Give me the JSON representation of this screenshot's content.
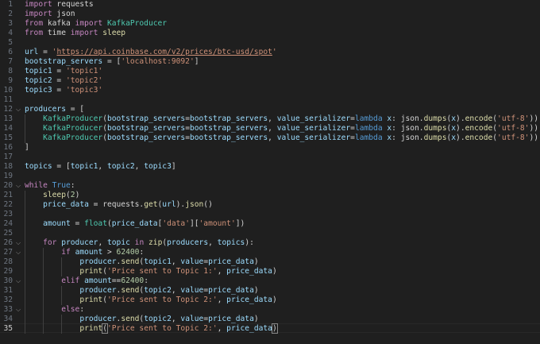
{
  "editor": {
    "language": "python",
    "active_line": 35,
    "colors": {
      "background": "#1f1f1f",
      "line_number": "#6e7681",
      "keyword_control": "#c586c0",
      "keyword": "#569cd6",
      "string": "#ce9178",
      "function": "#dcdcaa",
      "variable": "#9cdcfe",
      "number": "#b5cea8",
      "class": "#4ec9b0",
      "text": "#d4d4d4"
    },
    "folds": [
      {
        "line": 12,
        "icon": "chevron-down-icon"
      },
      {
        "line": 20,
        "icon": "chevron-down-icon"
      },
      {
        "line": 26,
        "icon": "chevron-down-icon"
      },
      {
        "line": 27,
        "icon": "chevron-down-icon"
      },
      {
        "line": 30,
        "icon": "chevron-down-icon"
      },
      {
        "line": 33,
        "icon": "chevron-down-icon"
      }
    ],
    "lines": [
      {
        "n": "1",
        "tokens": [
          [
            "import",
            "kw-ctrl"
          ],
          [
            " requests",
            "plain"
          ]
        ]
      },
      {
        "n": "2",
        "tokens": [
          [
            "import",
            "kw-ctrl"
          ],
          [
            " json",
            "plain"
          ]
        ]
      },
      {
        "n": "3",
        "tokens": [
          [
            "from",
            "kw-ctrl"
          ],
          [
            " kafka ",
            "plain"
          ],
          [
            "import",
            "kw-ctrl"
          ],
          [
            " KafkaProducer",
            "cls"
          ]
        ]
      },
      {
        "n": "4",
        "tokens": [
          [
            "from",
            "kw-ctrl"
          ],
          [
            " time ",
            "plain"
          ],
          [
            "import",
            "kw-ctrl"
          ],
          [
            " sleep",
            "fn"
          ]
        ]
      },
      {
        "n": "5",
        "tokens": []
      },
      {
        "n": "6",
        "tokens": [
          [
            "url",
            "var"
          ],
          [
            " = ",
            "plain"
          ],
          [
            "'",
            "str"
          ],
          [
            "https://api.coinbase.com/v2/prices/btc-usd/spot",
            "str url-link"
          ],
          [
            "'",
            "str"
          ]
        ]
      },
      {
        "n": "7",
        "tokens": [
          [
            "bootstrap_servers",
            "var"
          ],
          [
            " = [",
            "plain"
          ],
          [
            "'localhost:9092'",
            "str"
          ],
          [
            "]",
            "plain"
          ]
        ]
      },
      {
        "n": "8",
        "tokens": [
          [
            "topic1",
            "var"
          ],
          [
            " = ",
            "plain"
          ],
          [
            "'topic1'",
            "str"
          ]
        ]
      },
      {
        "n": "9",
        "tokens": [
          [
            "topic2",
            "var"
          ],
          [
            " = ",
            "plain"
          ],
          [
            "'topic2'",
            "str"
          ]
        ]
      },
      {
        "n": "10",
        "tokens": [
          [
            "topic3",
            "var"
          ],
          [
            " = ",
            "plain"
          ],
          [
            "'topic3'",
            "str"
          ]
        ]
      },
      {
        "n": "11",
        "tokens": []
      },
      {
        "n": "12",
        "tokens": [
          [
            "producers",
            "var"
          ],
          [
            " = [",
            "plain"
          ]
        ]
      },
      {
        "n": "13",
        "tokens": [
          [
            "    ",
            "plain"
          ],
          [
            "KafkaProducer",
            "cls"
          ],
          [
            "(",
            "plain"
          ],
          [
            "bootstrap_servers",
            "var"
          ],
          [
            "=",
            "plain"
          ],
          [
            "bootstrap_servers",
            "var"
          ],
          [
            ", ",
            "plain"
          ],
          [
            "value_serializer",
            "var"
          ],
          [
            "=",
            "plain"
          ],
          [
            "lambda",
            "kw"
          ],
          [
            " ",
            "plain"
          ],
          [
            "x",
            "var"
          ],
          [
            ": json.",
            "plain"
          ],
          [
            "dumps",
            "fn"
          ],
          [
            "(",
            "plain"
          ],
          [
            "x",
            "var"
          ],
          [
            ").",
            "plain"
          ],
          [
            "encode",
            "fn"
          ],
          [
            "(",
            "plain"
          ],
          [
            "'utf-8'",
            "str"
          ],
          [
            ")),",
            "plain"
          ]
        ]
      },
      {
        "n": "14",
        "tokens": [
          [
            "    ",
            "plain"
          ],
          [
            "KafkaProducer",
            "cls"
          ],
          [
            "(",
            "plain"
          ],
          [
            "bootstrap_servers",
            "var"
          ],
          [
            "=",
            "plain"
          ],
          [
            "bootstrap_servers",
            "var"
          ],
          [
            ", ",
            "plain"
          ],
          [
            "value_serializer",
            "var"
          ],
          [
            "=",
            "plain"
          ],
          [
            "lambda",
            "kw"
          ],
          [
            " ",
            "plain"
          ],
          [
            "x",
            "var"
          ],
          [
            ": json.",
            "plain"
          ],
          [
            "dumps",
            "fn"
          ],
          [
            "(",
            "plain"
          ],
          [
            "x",
            "var"
          ],
          [
            ").",
            "plain"
          ],
          [
            "encode",
            "fn"
          ],
          [
            "(",
            "plain"
          ],
          [
            "'utf-8'",
            "str"
          ],
          [
            ")),",
            "plain"
          ]
        ]
      },
      {
        "n": "15",
        "tokens": [
          [
            "    ",
            "plain"
          ],
          [
            "KafkaProducer",
            "cls"
          ],
          [
            "(",
            "plain"
          ],
          [
            "bootstrap_servers",
            "var"
          ],
          [
            "=",
            "plain"
          ],
          [
            "bootstrap_servers",
            "var"
          ],
          [
            ", ",
            "plain"
          ],
          [
            "value_serializer",
            "var"
          ],
          [
            "=",
            "plain"
          ],
          [
            "lambda",
            "kw"
          ],
          [
            " ",
            "plain"
          ],
          [
            "x",
            "var"
          ],
          [
            ": json.",
            "plain"
          ],
          [
            "dumps",
            "fn"
          ],
          [
            "(",
            "plain"
          ],
          [
            "x",
            "var"
          ],
          [
            ").",
            "plain"
          ],
          [
            "encode",
            "fn"
          ],
          [
            "(",
            "plain"
          ],
          [
            "'utf-8'",
            "str"
          ],
          [
            "))",
            "plain"
          ]
        ]
      },
      {
        "n": "16",
        "tokens": [
          [
            "]",
            "plain"
          ]
        ]
      },
      {
        "n": "17",
        "tokens": []
      },
      {
        "n": "18",
        "tokens": [
          [
            "topics",
            "var"
          ],
          [
            " = [",
            "plain"
          ],
          [
            "topic1",
            "var"
          ],
          [
            ", ",
            "plain"
          ],
          [
            "topic2",
            "var"
          ],
          [
            ", ",
            "plain"
          ],
          [
            "topic3",
            "var"
          ],
          [
            "]",
            "plain"
          ]
        ]
      },
      {
        "n": "19",
        "tokens": []
      },
      {
        "n": "20",
        "tokens": [
          [
            "while",
            "kw-ctrl"
          ],
          [
            " ",
            "plain"
          ],
          [
            "True",
            "kw"
          ],
          [
            ":",
            "plain"
          ]
        ]
      },
      {
        "n": "21",
        "tokens": [
          [
            "    ",
            "plain"
          ],
          [
            "sleep",
            "fn"
          ],
          [
            "(",
            "plain"
          ],
          [
            "2",
            "num"
          ],
          [
            ")",
            "plain"
          ]
        ]
      },
      {
        "n": "22",
        "tokens": [
          [
            "    ",
            "plain"
          ],
          [
            "price_data",
            "var"
          ],
          [
            " = requests.",
            "plain"
          ],
          [
            "get",
            "fn"
          ],
          [
            "(",
            "plain"
          ],
          [
            "url",
            "var"
          ],
          [
            ").",
            "plain"
          ],
          [
            "json",
            "fn"
          ],
          [
            "()",
            "plain"
          ]
        ]
      },
      {
        "n": "23",
        "tokens": []
      },
      {
        "n": "24",
        "tokens": [
          [
            "    ",
            "plain"
          ],
          [
            "amount",
            "var"
          ],
          [
            " = ",
            "plain"
          ],
          [
            "float",
            "cls"
          ],
          [
            "(",
            "plain"
          ],
          [
            "price_data",
            "var"
          ],
          [
            "[",
            "plain"
          ],
          [
            "'data'",
            "str"
          ],
          [
            "][",
            "plain"
          ],
          [
            "'amount'",
            "str"
          ],
          [
            "])",
            "plain"
          ]
        ]
      },
      {
        "n": "25",
        "tokens": []
      },
      {
        "n": "26",
        "tokens": [
          [
            "    ",
            "plain"
          ],
          [
            "for",
            "kw-ctrl"
          ],
          [
            " ",
            "plain"
          ],
          [
            "producer",
            "var"
          ],
          [
            ", ",
            "plain"
          ],
          [
            "topic",
            "var"
          ],
          [
            " ",
            "plain"
          ],
          [
            "in",
            "kw-ctrl"
          ],
          [
            " ",
            "plain"
          ],
          [
            "zip",
            "fn"
          ],
          [
            "(",
            "plain"
          ],
          [
            "producers",
            "var"
          ],
          [
            ", ",
            "plain"
          ],
          [
            "topics",
            "var"
          ],
          [
            "):",
            "plain"
          ]
        ]
      },
      {
        "n": "27",
        "tokens": [
          [
            "        ",
            "plain"
          ],
          [
            "if",
            "kw-ctrl"
          ],
          [
            " ",
            "plain"
          ],
          [
            "amount",
            "var"
          ],
          [
            " > ",
            "plain"
          ],
          [
            "62400",
            "num"
          ],
          [
            ":",
            "plain"
          ]
        ]
      },
      {
        "n": "28",
        "tokens": [
          [
            "            ",
            "plain"
          ],
          [
            "producer",
            "var"
          ],
          [
            ".",
            "plain"
          ],
          [
            "send",
            "fn"
          ],
          [
            "(",
            "plain"
          ],
          [
            "topic1",
            "var"
          ],
          [
            ", ",
            "plain"
          ],
          [
            "value",
            "var"
          ],
          [
            "=",
            "plain"
          ],
          [
            "price_data",
            "var"
          ],
          [
            ")",
            "plain"
          ]
        ]
      },
      {
        "n": "29",
        "tokens": [
          [
            "            ",
            "plain"
          ],
          [
            "print",
            "fn"
          ],
          [
            "(",
            "plain"
          ],
          [
            "'Price sent to Topic 1:'",
            "str"
          ],
          [
            ", ",
            "plain"
          ],
          [
            "price_data",
            "var"
          ],
          [
            ")",
            "plain"
          ]
        ]
      },
      {
        "n": "30",
        "tokens": [
          [
            "        ",
            "plain"
          ],
          [
            "elif",
            "kw-ctrl"
          ],
          [
            " ",
            "plain"
          ],
          [
            "amount",
            "var"
          ],
          [
            "==",
            "plain"
          ],
          [
            "62400",
            "num"
          ],
          [
            ":",
            "plain"
          ]
        ]
      },
      {
        "n": "31",
        "tokens": [
          [
            "            ",
            "plain"
          ],
          [
            "producer",
            "var"
          ],
          [
            ".",
            "plain"
          ],
          [
            "send",
            "fn"
          ],
          [
            "(",
            "plain"
          ],
          [
            "topic2",
            "var"
          ],
          [
            ", ",
            "plain"
          ],
          [
            "value",
            "var"
          ],
          [
            "=",
            "plain"
          ],
          [
            "price_data",
            "var"
          ],
          [
            ")",
            "plain"
          ]
        ]
      },
      {
        "n": "32",
        "tokens": [
          [
            "            ",
            "plain"
          ],
          [
            "print",
            "fn"
          ],
          [
            "(",
            "plain"
          ],
          [
            "'Price sent to Topic 2:'",
            "str"
          ],
          [
            ", ",
            "plain"
          ],
          [
            "price_data",
            "var"
          ],
          [
            ")",
            "plain"
          ]
        ]
      },
      {
        "n": "33",
        "tokens": [
          [
            "        ",
            "plain"
          ],
          [
            "else",
            "kw-ctrl"
          ],
          [
            ":",
            "plain"
          ]
        ]
      },
      {
        "n": "34",
        "tokens": [
          [
            "            ",
            "plain"
          ],
          [
            "producer",
            "var"
          ],
          [
            ".",
            "plain"
          ],
          [
            "send",
            "fn"
          ],
          [
            "(",
            "plain"
          ],
          [
            "topic2",
            "var"
          ],
          [
            ", ",
            "plain"
          ],
          [
            "value",
            "var"
          ],
          [
            "=",
            "plain"
          ],
          [
            "price_data",
            "var"
          ],
          [
            ")",
            "plain"
          ]
        ]
      },
      {
        "n": "35",
        "tokens": [
          [
            "            ",
            "plain"
          ],
          [
            "print",
            "fn"
          ],
          [
            "(",
            "plain bracket-match"
          ],
          [
            "'Price sent to Topic 2:'",
            "str"
          ],
          [
            ", ",
            "plain"
          ],
          [
            "price_data",
            "var"
          ],
          [
            ")",
            "plain bracket-match"
          ]
        ]
      }
    ]
  }
}
